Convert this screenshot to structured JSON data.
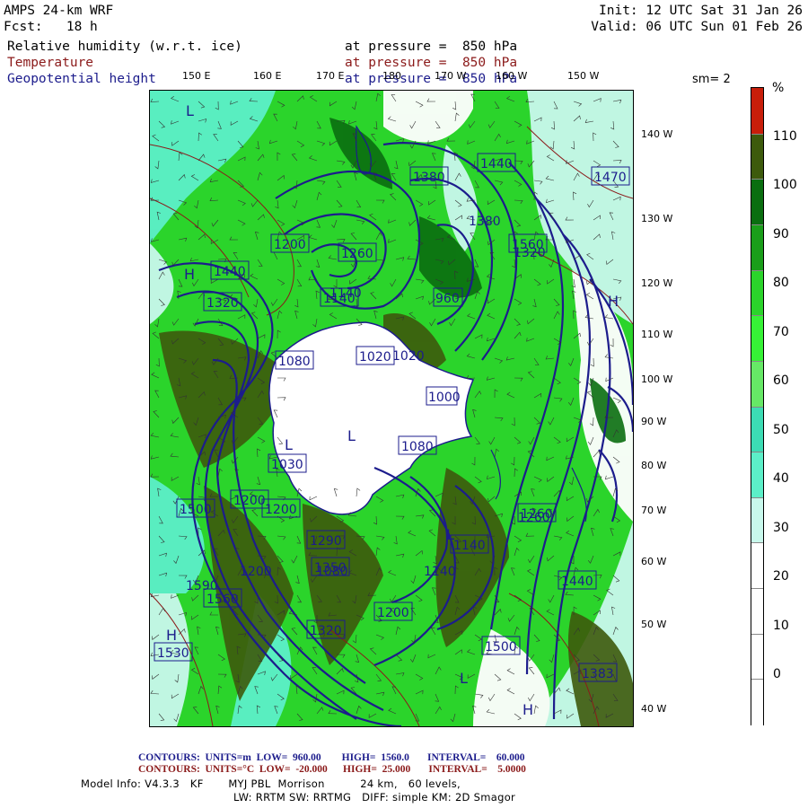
{
  "header": {
    "model": "AMPS 24-km WRF",
    "init": "Init: 12 UTC Sat 31 Jan 26",
    "fcst": "Fcst:   18 h",
    "valid": "Valid: 06 UTC Sun 01 Feb 26",
    "fields": [
      {
        "name": "Relative humidity (w.r.t. ice)",
        "level": "at pressure =  850 hPa",
        "color": "#000000"
      },
      {
        "name": "Temperature",
        "level": "at pressure =  850 hPa",
        "color": "#8b1a1a"
      },
      {
        "name": "Geopotential height",
        "level": "at pressure =  850 hPa",
        "color": "#1c1c8c"
      }
    ],
    "smoothing": "sm= 2"
  },
  "lon_labels": [
    "150 E",
    "160 E",
    "170 E",
    "180",
    "170 W",
    "160 W",
    "150 W"
  ],
  "lat_labels": [
    "140 W",
    "130 W",
    "120 W",
    "110 W",
    "100 W",
    "90 W",
    "80 W",
    "70 W",
    "60 W",
    "50 W",
    "40 W"
  ],
  "colorbar": {
    "unit": "%",
    "labels": [
      "110",
      "100",
      "90",
      "80",
      "70",
      "60",
      "50",
      "40",
      "30",
      "20",
      "10",
      "0"
    ],
    "colors": [
      "#c81e0a",
      "#3d5a0c",
      "#0a6e10",
      "#1a9e1a",
      "#2bd42b",
      "#36f236",
      "#66e866",
      "#3cdcb4",
      "#5cefc8",
      "#c8f8ec",
      "#ffffff",
      "#ffffff",
      "#ffffff",
      "#ffffff"
    ]
  },
  "height_labels": [
    "1440",
    "1320",
    "1200",
    "1260",
    "1380",
    "1080",
    "1500",
    "1140",
    "1020",
    "960",
    "1560",
    "1530",
    "1470",
    "1560",
    "1590",
    "1383",
    "1290",
    "1200",
    "1350",
    "1080",
    "1200",
    "1140",
    "1320",
    "1200",
    "1140",
    "1260",
    "1320",
    "1440",
    "1140",
    "1440",
    "1500",
    "1080",
    "1030",
    "1020",
    "1000",
    "1260",
    "1200",
    "1380"
  ],
  "lh_labels": [
    "L",
    "H",
    "L",
    "H",
    "L",
    "L",
    "H",
    "L",
    "H"
  ],
  "footer": {
    "contours_height": "CONTOURS:  UNITS=m  LOW=  960.00        HIGH=  1560.0       INTERVAL=    60.000",
    "contours_temp": "CONTOURS:  UNITS=°C  LOW=  -20.000      HIGH=  25.000       INTERVAL=    5.0000",
    "model_info": "Model Info: V4.3.3   KF       MYJ PBL  Morrison          24 km,   60 levels,",
    "model_info2": "LW: RRTM SW: RRTMG   DIFF: simple KM: 2D Smagor"
  }
}
